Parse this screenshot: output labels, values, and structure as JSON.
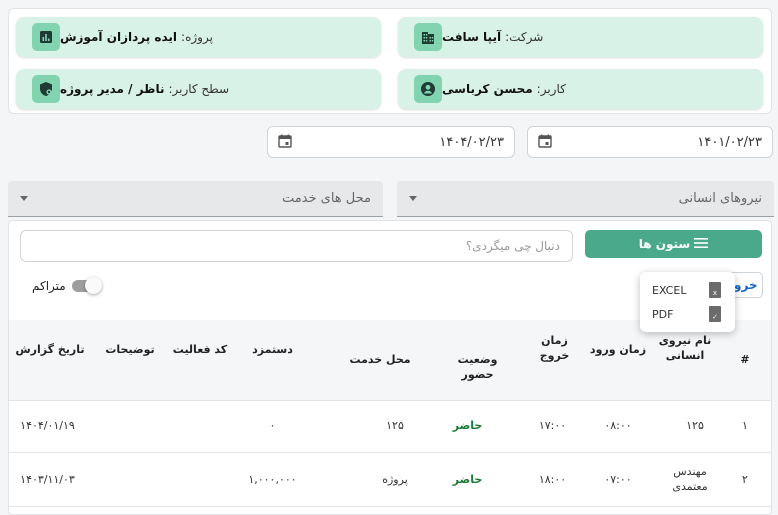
{
  "info": {
    "company": {
      "label": "شرکت:",
      "value": "آیپا سافت",
      "icon": "building-icon"
    },
    "project": {
      "label": "پروژه:",
      "value": "ایده پردازان آموزش",
      "icon": "chart-icon"
    },
    "user": {
      "label": "کاربر:",
      "value": "محسن کرباسی",
      "icon": "user-icon"
    },
    "access": {
      "label": "سطح کاربر:",
      "value": "ناظر / مدیر پروژه",
      "icon": "shield-icon"
    }
  },
  "dates": {
    "from": "۱۴۰۱/۰۲/۲۳",
    "to": "۱۴۰۴/۰۲/۲۳"
  },
  "filters": {
    "workforce": "نیروهای انسانی",
    "service_location": "محل های خدمت"
  },
  "toolbar": {
    "columns_label": "ستون ها",
    "search_placeholder": "دنبال چی میگردی؟",
    "export_label": "خرو",
    "cumulative_label": "متراکم"
  },
  "export_menu": {
    "excel": "EXCEL",
    "pdf": "PDF"
  },
  "table": {
    "headers": {
      "index": "#",
      "workforce_name": "نام نیروی انسانی",
      "entry_time": "زمان ورود",
      "exit_time": "زمان خروج",
      "attendance_status": "وضعیت حضور",
      "service_location": "محل خدمت",
      "wage": "دستمزد",
      "activity_code": "کد فعالیت",
      "description": "توضیحات",
      "report_date": "تاریخ گزارش"
    },
    "rows": [
      {
        "index": "۱",
        "name": "۱۲۵",
        "entry": "۰۸:۰۰",
        "exit": "۱۷:۰۰",
        "status": "حاضر",
        "location": "۱۲۵",
        "wage": "۰",
        "code": "",
        "desc": "",
        "date": "۱۴۰۴/۰۱/۱۹"
      },
      {
        "index": "۲",
        "name": "مهندس معتمدی",
        "entry": "۰۷:۰۰",
        "exit": "۱۸:۰۰",
        "status": "حاضر",
        "location": "پروژه",
        "wage": "۱,۰۰۰,۰۰۰",
        "code": "",
        "desc": "",
        "date": "۱۴۰۳/۱۱/۰۳"
      }
    ]
  }
}
